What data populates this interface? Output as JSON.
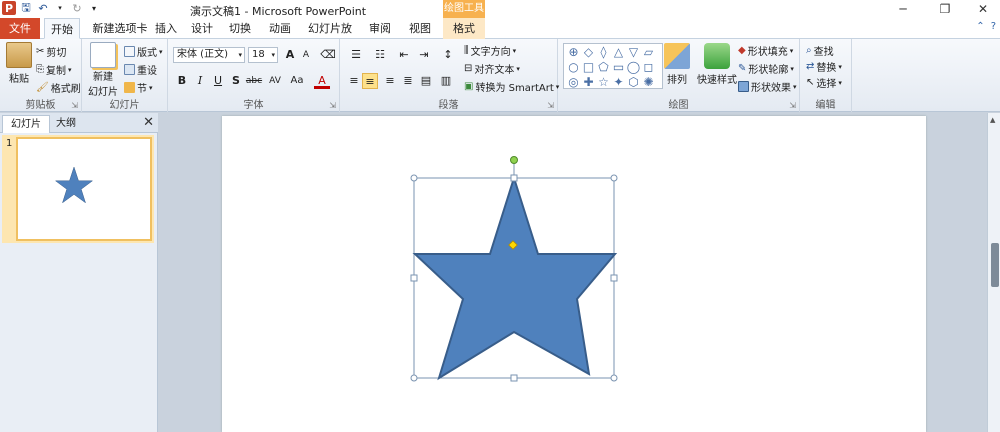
{
  "window": {
    "title": "演示文稿1 - Microsoft PowerPoint",
    "context_tab_header": "绘图工具",
    "controls": {
      "minimize": "─",
      "restore": "❐",
      "close": "✕"
    },
    "app_icon_letter": "P"
  },
  "tabs": [
    {
      "label": "文件"
    },
    {
      "label": "开始"
    },
    {
      "label": "新建选项卡"
    },
    {
      "label": "插入"
    },
    {
      "label": "设计"
    },
    {
      "label": "切换"
    },
    {
      "label": "动画"
    },
    {
      "label": "幻灯片放映"
    },
    {
      "label": "审阅"
    },
    {
      "label": "视图"
    },
    {
      "label": "格式"
    }
  ],
  "ribbon": {
    "clipboard": {
      "label": "剪贴板",
      "paste": "粘贴",
      "cut": "剪切",
      "copy": "复制",
      "format_painter": "格式刷"
    },
    "slides": {
      "label": "幻灯片",
      "new_slide": "新建",
      "new_slide_2": "幻灯片",
      "layout": "版式",
      "reset": "重设",
      "section": "节"
    },
    "font": {
      "label": "字体",
      "font_name": "宋体 (正文)",
      "font_size": "18",
      "grow": "A",
      "shrink": "A",
      "bold": "B",
      "italic": "I",
      "underline": "U",
      "shadow": "S",
      "strike": "abc",
      "spacing": "AV",
      "case": "Aa",
      "color": "A"
    },
    "paragraph": {
      "label": "段落",
      "text_direction": "文字方向",
      "align_text": "对齐文本",
      "smartart": "转换为 SmartArt"
    },
    "drawing": {
      "label": "绘图",
      "arrange": "排列",
      "quick_styles": "快速样式",
      "shape_fill": "形状填充",
      "shape_outline": "形状轮廓",
      "shape_effects": "形状效果",
      "shape_glyphs": [
        "⊕",
        "◇",
        "◊",
        "△",
        "▽",
        "▱",
        "○",
        "□",
        "⬠",
        "▭",
        "◯",
        "◻",
        "◎",
        "✚",
        "☆",
        "✦",
        "⬡",
        "✺"
      ]
    },
    "editing": {
      "label": "编辑",
      "find": "查找",
      "replace": "替换",
      "select": "选择"
    }
  },
  "left_pane": {
    "tabs": [
      {
        "label": "幻灯片"
      },
      {
        "label": "大纲"
      }
    ],
    "close": "✕",
    "slides": [
      {
        "number": "1"
      }
    ]
  },
  "colors": {
    "star_fill": "#4f81bd",
    "star_stroke": "#385d8a",
    "file_tab": "#d3482a",
    "context_tab": "#f7b14f",
    "rotation_handle": "#8fd14f",
    "adjust_handle": "#ffd700"
  }
}
